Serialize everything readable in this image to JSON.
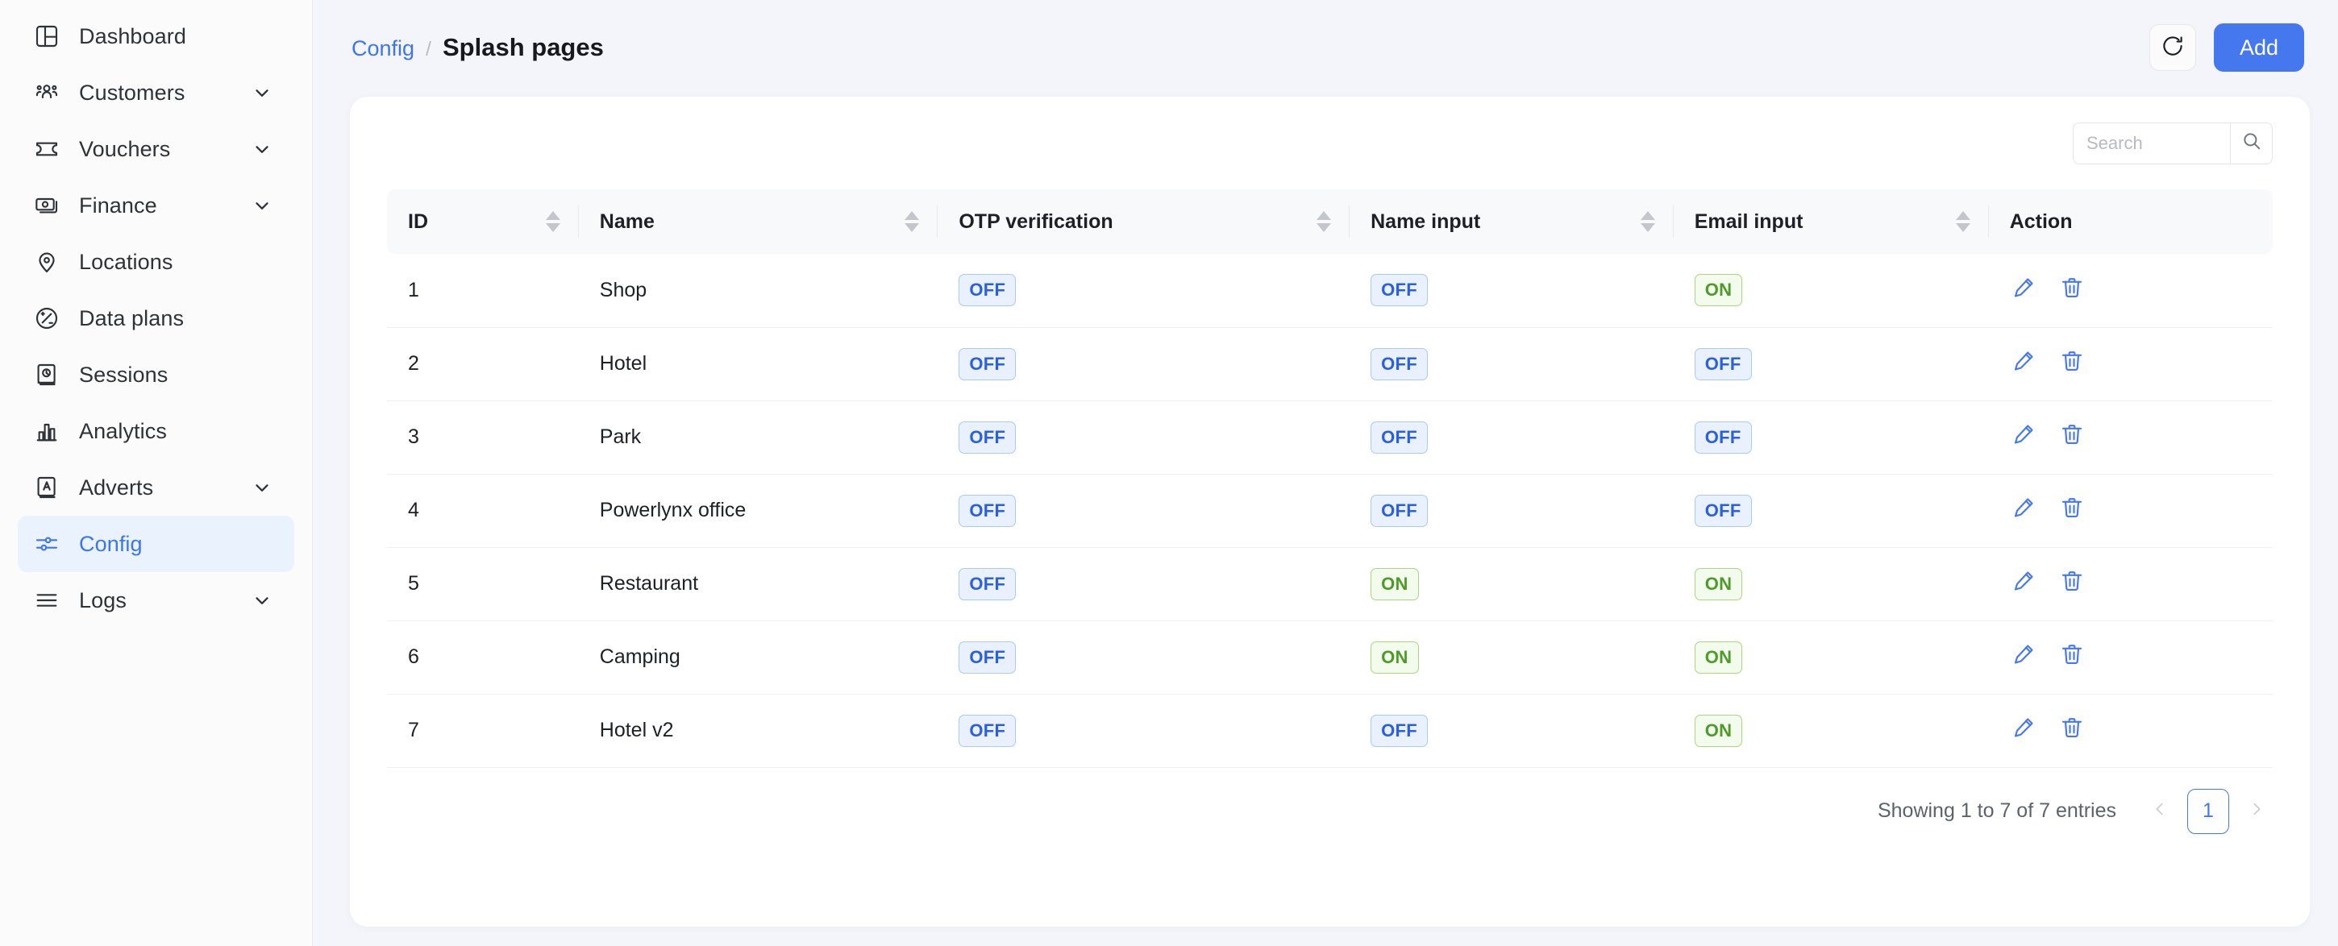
{
  "colors": {
    "accent": "#4577ef",
    "link": "#3b76ef",
    "badge_off_bg": "#e9f1fe",
    "badge_off_text": "#2c5fe0",
    "badge_on_bg": "#f3fbec",
    "badge_on_text": "#4e9a2a",
    "page_bg": "#f4f5fa",
    "card_bg": "#ffffff",
    "sidebar_bg": "#fbfbfc",
    "active_nav_bg": "#eaf2fe"
  },
  "sidebar": {
    "items": [
      {
        "label": "Dashboard",
        "icon": "dashboard-icon",
        "expandable": false,
        "active": false
      },
      {
        "label": "Customers",
        "icon": "users-icon",
        "expandable": true,
        "active": false
      },
      {
        "label": "Vouchers",
        "icon": "ticket-icon",
        "expandable": true,
        "active": false
      },
      {
        "label": "Finance",
        "icon": "banknote-icon",
        "expandable": true,
        "active": false
      },
      {
        "label": "Locations",
        "icon": "map-pin-icon",
        "expandable": false,
        "active": false
      },
      {
        "label": "Data plans",
        "icon": "data-plan-icon",
        "expandable": false,
        "active": false
      },
      {
        "label": "Sessions",
        "icon": "sessions-icon",
        "expandable": false,
        "active": false
      },
      {
        "label": "Analytics",
        "icon": "bar-chart-icon",
        "expandable": false,
        "active": false
      },
      {
        "label": "Adverts",
        "icon": "advert-icon",
        "expandable": true,
        "active": false
      },
      {
        "label": "Config",
        "icon": "sliders-icon",
        "expandable": false,
        "active": true
      },
      {
        "label": "Logs",
        "icon": "list-icon",
        "expandable": true,
        "active": false
      }
    ]
  },
  "header": {
    "breadcrumb_parent": "Config",
    "breadcrumb_separator": "/",
    "breadcrumb_current": "Splash pages",
    "refresh_icon": "refresh-icon",
    "add_label": "Add"
  },
  "search": {
    "placeholder": "Search",
    "value": "",
    "icon": "search-icon"
  },
  "table": {
    "columns": [
      {
        "label": "ID",
        "sortable": true
      },
      {
        "label": "Name",
        "sortable": true
      },
      {
        "label": "OTP verification",
        "sortable": true
      },
      {
        "label": "Name input",
        "sortable": true
      },
      {
        "label": "Email input",
        "sortable": true
      },
      {
        "label": "Action",
        "sortable": false
      }
    ],
    "rows": [
      {
        "id": "1",
        "name": "Shop",
        "otp": "OFF",
        "name_input": "OFF",
        "email_input": "ON"
      },
      {
        "id": "2",
        "name": "Hotel",
        "otp": "OFF",
        "name_input": "OFF",
        "email_input": "OFF"
      },
      {
        "id": "3",
        "name": "Park",
        "otp": "OFF",
        "name_input": "OFF",
        "email_input": "OFF"
      },
      {
        "id": "4",
        "name": "Powerlynx office",
        "otp": "OFF",
        "name_input": "OFF",
        "email_input": "OFF"
      },
      {
        "id": "5",
        "name": "Restaurant",
        "otp": "OFF",
        "name_input": "ON",
        "email_input": "ON"
      },
      {
        "id": "6",
        "name": "Camping",
        "otp": "OFF",
        "name_input": "ON",
        "email_input": "ON"
      },
      {
        "id": "7",
        "name": "Hotel v2",
        "otp": "OFF",
        "name_input": "OFF",
        "email_input": "ON"
      }
    ],
    "row_actions": [
      {
        "name": "edit-row-button",
        "icon": "pencil-icon"
      },
      {
        "name": "delete-row-button",
        "icon": "trash-icon"
      }
    ]
  },
  "footer": {
    "entries_text": "Showing 1 to 7 of 7 entries",
    "prev_label": "‹",
    "next_label": "›",
    "pages": [
      "1"
    ],
    "current_page": "1"
  }
}
